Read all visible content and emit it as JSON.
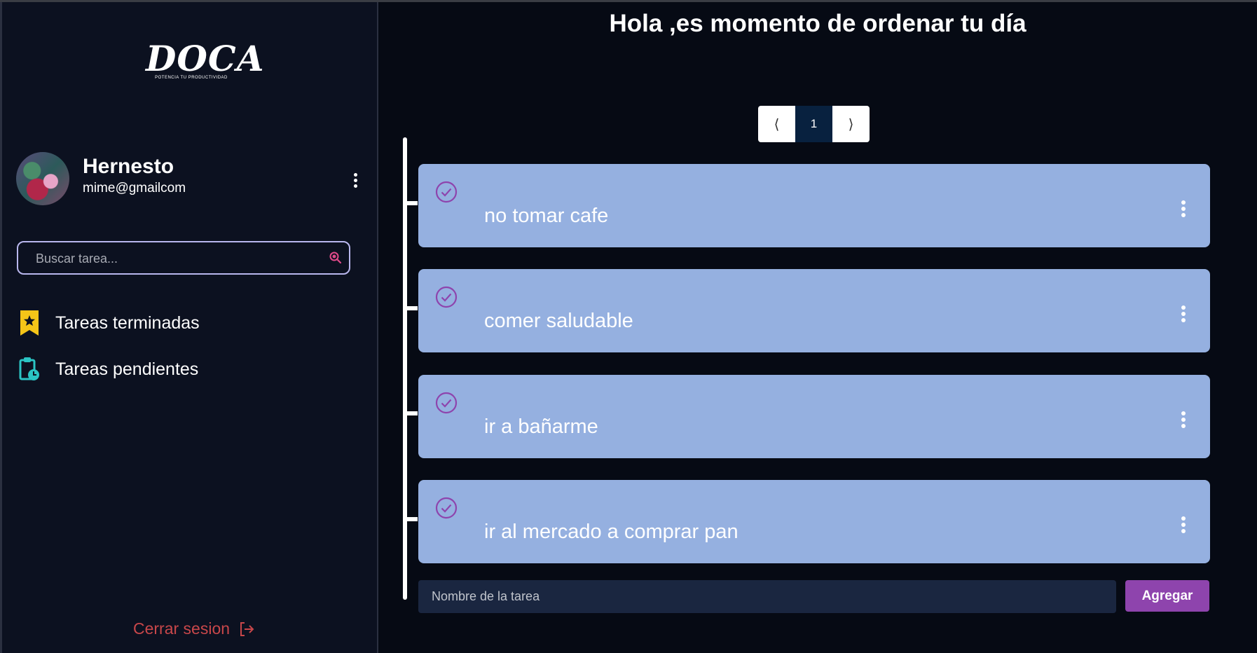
{
  "sidebar": {
    "logo_word": "DOCA",
    "logo_tagline": "POTENCIA TU PRODUCTIVIDAD",
    "user": {
      "name": "Hernesto",
      "email": "mime@gmailcom"
    },
    "search": {
      "placeholder": "Buscar tarea..."
    },
    "nav": [
      {
        "label": "Tareas terminadas",
        "icon": "bookmark-star-icon",
        "color": "#f5c518"
      },
      {
        "label": "Tareas pendientes",
        "icon": "clipboard-clock-icon",
        "color": "#2bc4c4"
      }
    ],
    "logout_label": "Cerrar sesion"
  },
  "main": {
    "heading": "Hola ,es momento de ordenar tu día",
    "pagination": {
      "prev": "⟨",
      "current": "1",
      "next": "⟩"
    },
    "tasks": [
      {
        "label": "no tomar cafe"
      },
      {
        "label": "comer saludable"
      },
      {
        "label": "ir a bañarme"
      },
      {
        "label": "ir al mercado a comprar pan"
      }
    ],
    "new_task": {
      "placeholder": "Nombre de la tarea",
      "button_label": "Agregar"
    }
  },
  "colors": {
    "accent": "#8e44ad",
    "task_bg": "#95b0e0",
    "logout": "#c8474a"
  }
}
